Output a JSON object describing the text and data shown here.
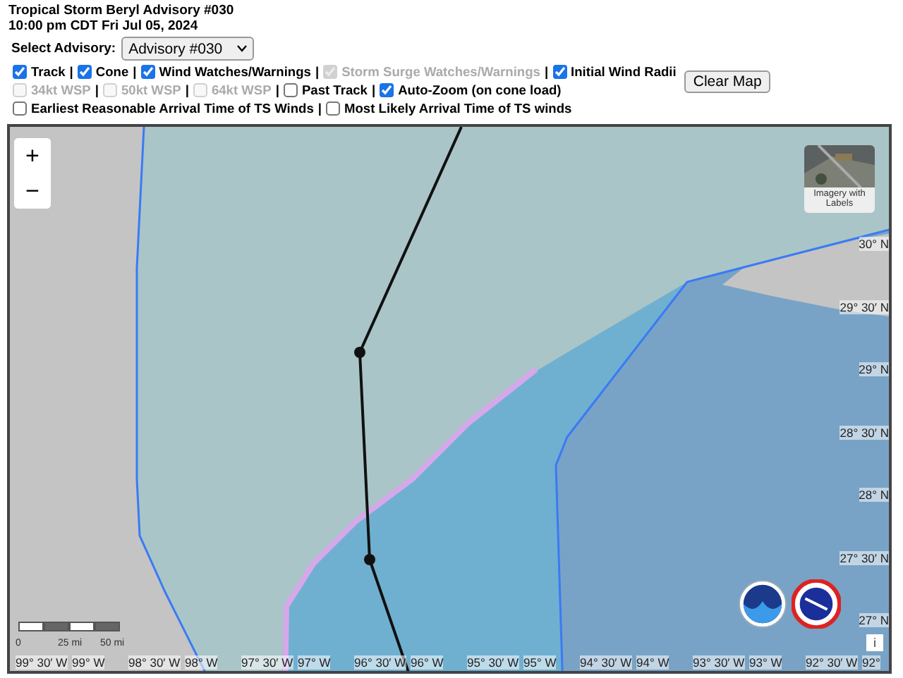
{
  "title": "Tropical Storm Beryl Advisory #030",
  "issued": "10:00 pm CDT Fri Jul 05, 2024",
  "advisory_select": {
    "label": "Select Advisory:",
    "value": "Advisory #030"
  },
  "layer_rows": [
    [
      {
        "label": "Track",
        "checked": true,
        "disabled": false,
        "separator": "|"
      },
      {
        "label": "Cone",
        "checked": true,
        "disabled": false,
        "separator": "|"
      },
      {
        "label": "Wind Watches/Warnings",
        "checked": true,
        "disabled": false,
        "separator": "|"
      },
      {
        "label": "Storm Surge Watches/Warnings",
        "checked": true,
        "disabled": true,
        "separator": "|"
      },
      {
        "label": "Initial Wind Radii",
        "checked": true,
        "disabled": false
      }
    ],
    [
      {
        "label": "34kt WSP",
        "checked": false,
        "disabled": true,
        "separator": "|"
      },
      {
        "label": "50kt WSP",
        "checked": false,
        "disabled": true,
        "separator": "|"
      },
      {
        "label": "64kt WSP",
        "checked": false,
        "disabled": true,
        "separator": "|"
      },
      {
        "label": "Past Track",
        "checked": false,
        "disabled": false,
        "separator": "|"
      },
      {
        "label": "Auto-Zoom (on cone load)",
        "checked": true,
        "disabled": false
      }
    ],
    [
      {
        "label": "Earliest Reasonable Arrival Time of TS Winds",
        "checked": false,
        "disabled": false,
        "separator": "|"
      },
      {
        "label": "Most Likely Arrival Time of TS winds",
        "checked": false,
        "disabled": false
      }
    ]
  ],
  "clear_button": "Clear Map",
  "map": {
    "zoom_in": "+",
    "zoom_out": "−",
    "basemap_button": "Imagery with Labels",
    "scale_labels": [
      "0",
      "25 mi",
      "50 mi"
    ],
    "latitude_labels": [
      "30° N",
      "29° 30′ N",
      "29° N",
      "28° 30′ N",
      "28° N",
      "27° 30′ N",
      "27° N"
    ],
    "longitude_labels": [
      "99° 30′ W",
      "99° W",
      "98° 30′ W",
      "98° W",
      "97° 30′ W",
      "97° W",
      "96° 30′ W",
      "96° W",
      "95° 30′ W",
      "95° W",
      "94° 30′ W",
      "94° W",
      "93° 30′ W",
      "93° W",
      "92° 30′ W",
      "92°"
    ],
    "info_button": "i"
  }
}
